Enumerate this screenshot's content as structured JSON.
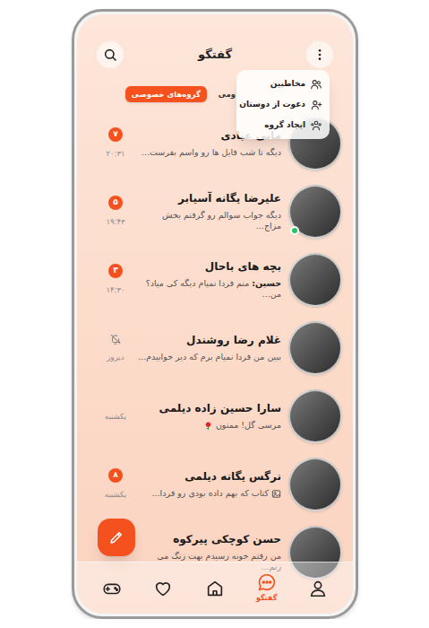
{
  "header": {
    "title": "گفتگو"
  },
  "menu": {
    "open": true,
    "items": [
      {
        "label": "مخاطبین",
        "kind": "contacts"
      },
      {
        "label": "دعوت از دوستان",
        "kind": "invite"
      },
      {
        "label": "ایجاد گروه",
        "kind": "group"
      }
    ]
  },
  "tabs": [
    {
      "label": "ومی",
      "selected": false
    },
    {
      "label": "گروه‌های خصوصی",
      "selected": true
    }
  ],
  "chats": [
    {
      "name": "مانی عبادی",
      "sender": null,
      "preview": "دیگه تا شب فایل ها رو واسم بفرست...",
      "kind": "plain",
      "time": "۲۰:۳۱",
      "unread": "۷",
      "muted": false,
      "online": false
    },
    {
      "name": "علیرضا یگانه آسیابر",
      "sender": null,
      "preview": "دیگه جواب سوالم رو گرفتم بخش مزاج...",
      "kind": "plain",
      "time": "۱۹:۴۳",
      "unread": "۵",
      "muted": false,
      "online": true
    },
    {
      "name": "بچه های باحال",
      "sender": "حسین:",
      "preview": "منم فردا نمیام دیگه کی میاد؟ من...",
      "kind": "plain",
      "time": "۱۴:۳۰",
      "unread": "۳",
      "muted": false,
      "online": false
    },
    {
      "name": "غلام رضا روشندل",
      "sender": null,
      "preview": "ببین من فردا نمیام برم که دیر خوابیدم...",
      "kind": "plain",
      "time": "دیروز",
      "unread": null,
      "muted": true,
      "online": false
    },
    {
      "name": "سارا حسین زاده دیلمی",
      "sender": null,
      "preview": "مرسی گل! ممنون",
      "kind": "sticker",
      "time": "یکشنبه",
      "unread": null,
      "muted": false,
      "online": false
    },
    {
      "name": "نرگس یگانه دیلمی",
      "sender": null,
      "preview": "کتاب که بهم داده بودی رو فردا...",
      "kind": "media",
      "time": "یکشنبه",
      "unread": "۸",
      "muted": false,
      "online": false
    },
    {
      "name": "حسن کوچکی پیرکوه",
      "sender": null,
      "preview": "من رفتم خونه رسیدم بهت زنگ می زنم...",
      "kind": "plain",
      "time": "",
      "unread": null,
      "muted": false,
      "online": false
    }
  ],
  "nav": [
    {
      "kind": "profile",
      "label": null,
      "selected": false
    },
    {
      "kind": "chat",
      "label": "گفتگو",
      "selected": true
    },
    {
      "kind": "home",
      "label": null,
      "selected": false
    },
    {
      "kind": "favorites",
      "label": null,
      "selected": false
    },
    {
      "kind": "games",
      "label": null,
      "selected": false
    }
  ]
}
